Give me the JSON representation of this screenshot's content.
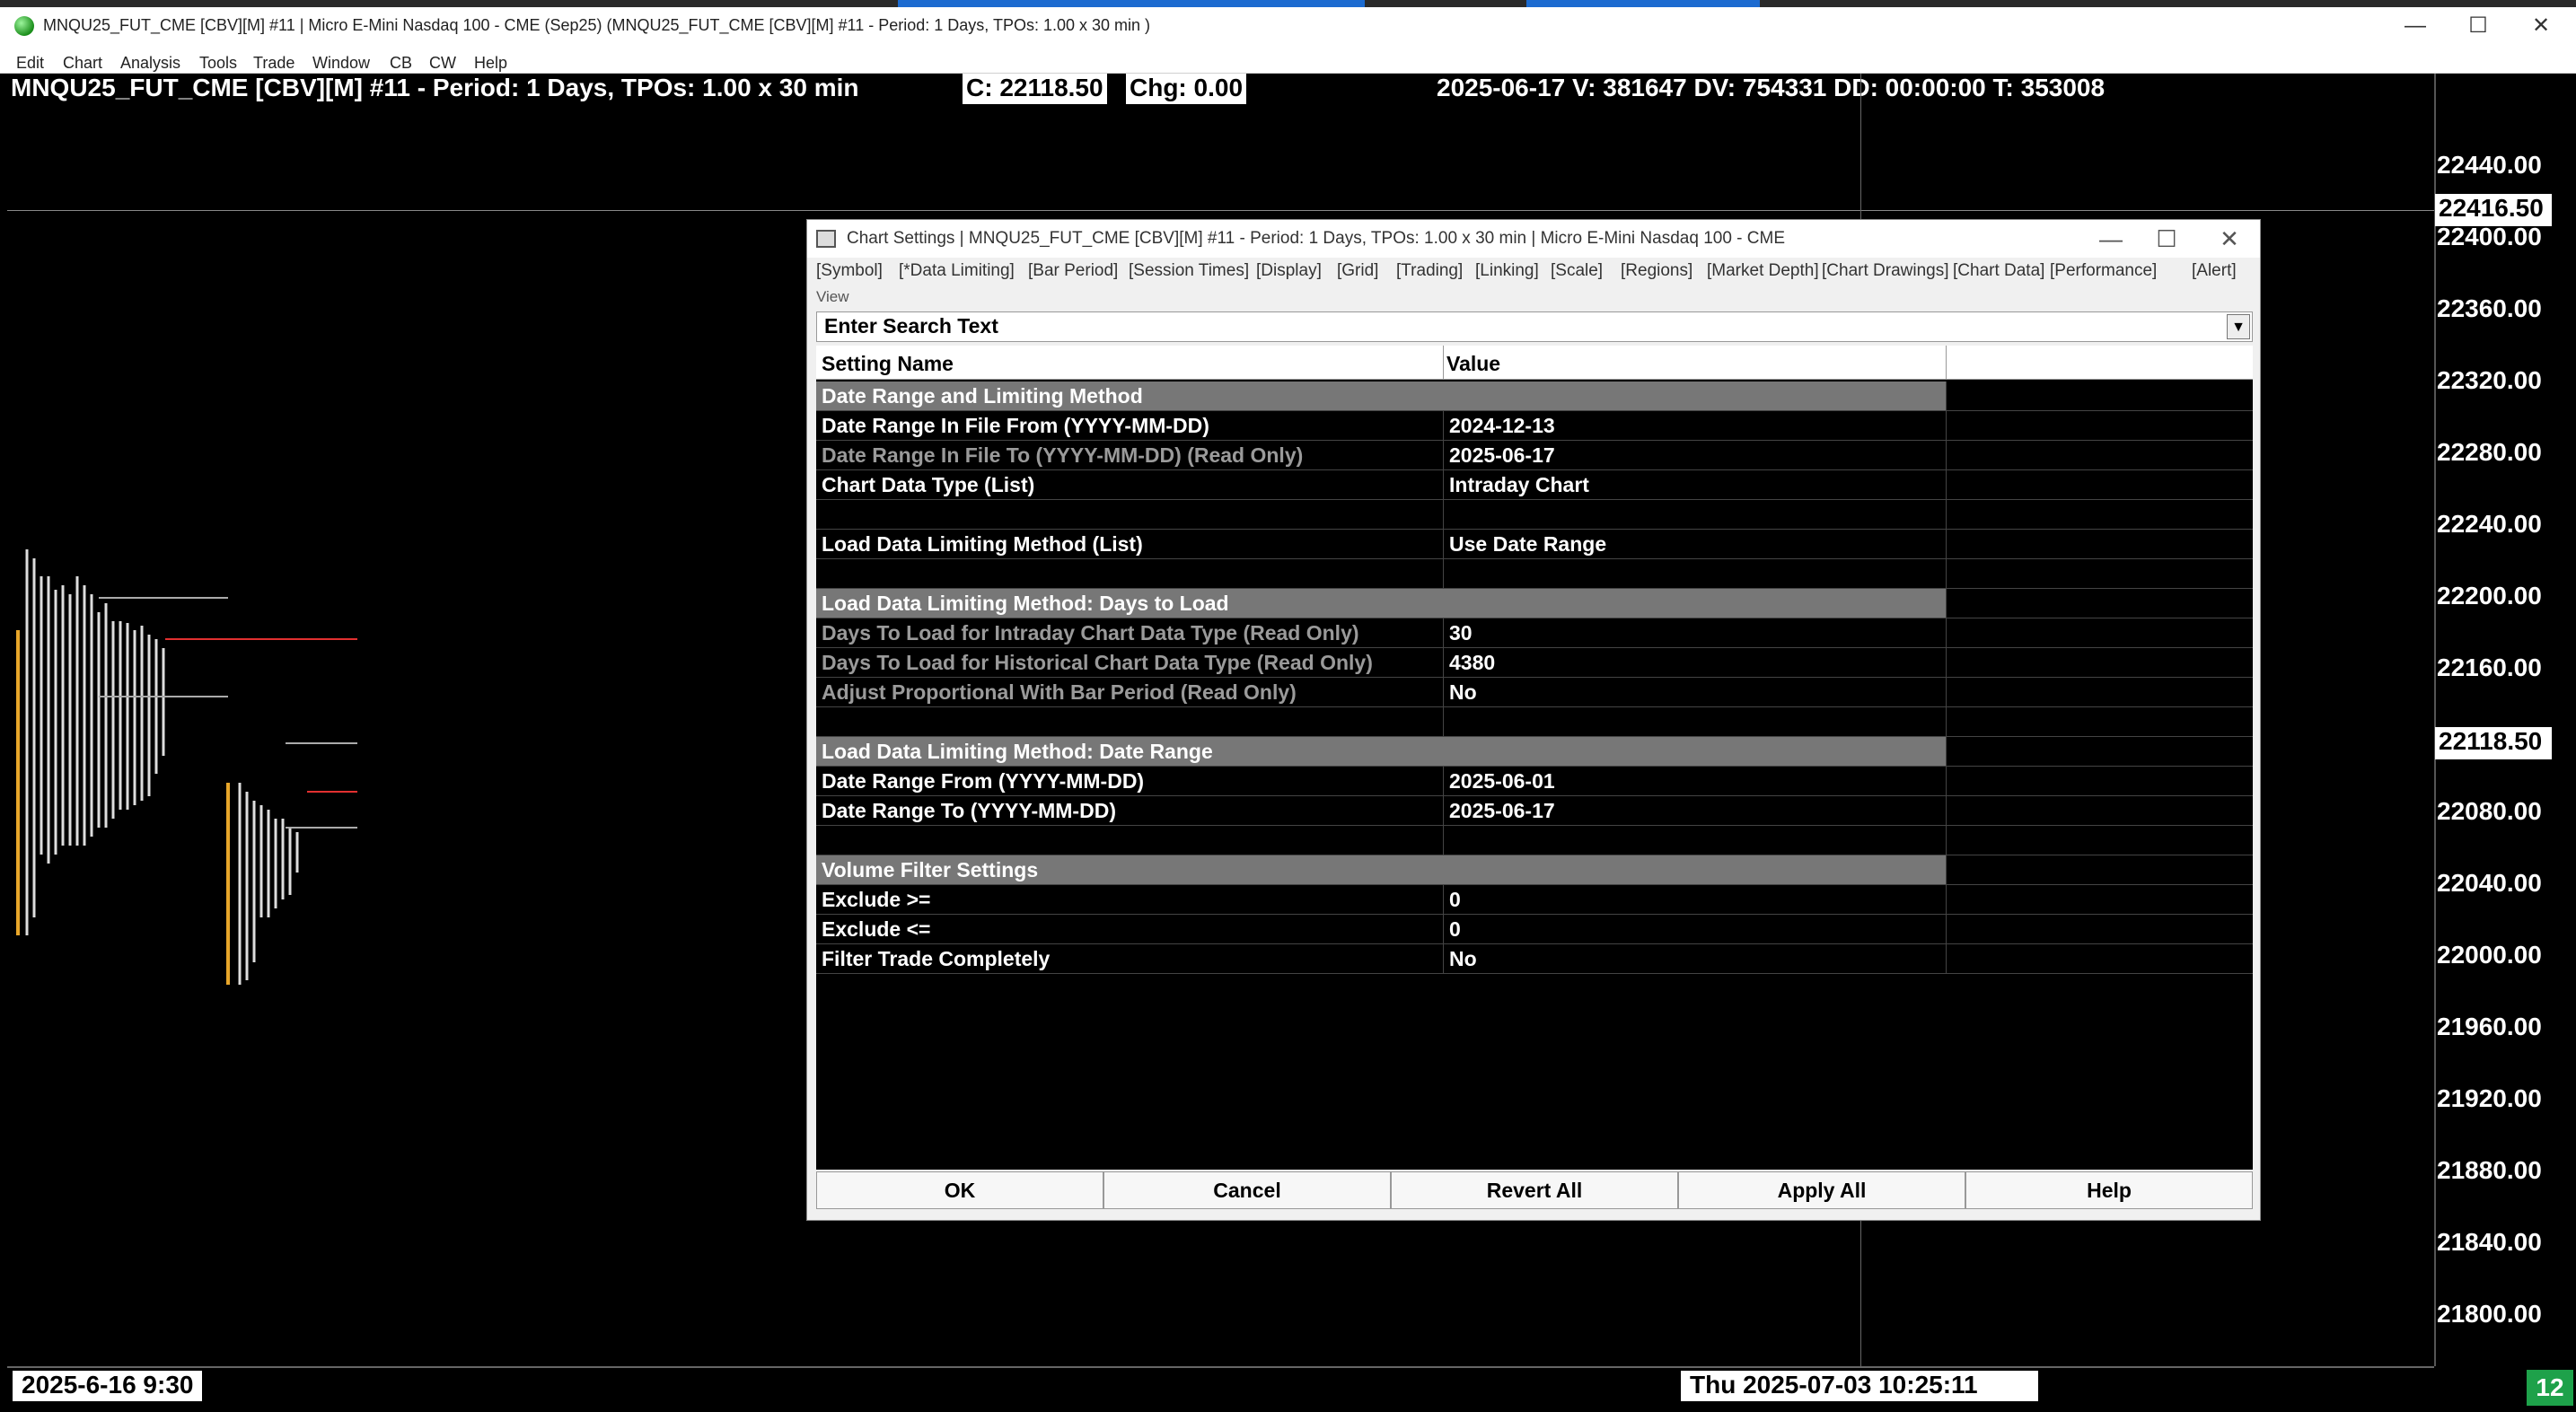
{
  "window": {
    "title": "MNQU25_FUT_CME [CBV][M] #11 | Micro E-Mini Nasdaq 100 - CME (Sep25) (MNQU25_FUT_CME [CBV][M] #11 - Period: 1 Days, TPOs: 1.00 x 30 min )"
  },
  "menu": [
    "Edit",
    "Chart",
    "Analysis",
    "Tools",
    "Trade",
    "Window",
    "CB",
    "CW",
    "Help"
  ],
  "chart": {
    "header_symbol": "MNQU25_FUT_CME [CBV][M] #11 - Period: 1 Days, TPOs: 1.00 x 30 min",
    "close": "C: 22118.50",
    "change": "Chg: 0.00",
    "stats": "2025-06-17 V: 381647 DV: 754331 DD: 00:00:00 T: 353008",
    "price_ticks": [
      "22440.00",
      "22400.00",
      "22360.00",
      "22320.00",
      "22280.00",
      "22240.00",
      "22200.00",
      "22160.00",
      "22080.00",
      "22040.00",
      "22000.00",
      "21960.00",
      "21920.00",
      "21880.00",
      "21840.00",
      "21800.00"
    ],
    "price_high_box": "22416.50",
    "price_last_box": "22118.50",
    "start_time": "2025-6-16  9:30",
    "cursor_time": "Thu 2025-07-03  10:25:11",
    "counter": "12"
  },
  "dialog": {
    "title": "Chart Settings | MNQU25_FUT_CME [CBV][M] #11 - Period: 1 Days, TPOs: 1.00 x 30 min  | Micro E-Mini Nasdaq 100 - CME",
    "tabs": [
      "[Symbol]",
      "[*Data Limiting]",
      "[Bar Period]",
      "[Session Times]",
      "[Display]",
      "[Grid]",
      "[Trading]",
      "[Linking]",
      "[Scale]",
      "[Regions]",
      "[Market Depth]",
      "[Chart Drawings]",
      "[Chart Data]",
      "[Performance]",
      "[Alert]"
    ],
    "view_label": "View",
    "search_placeholder": "Enter Search Text",
    "col_name": "Setting Name",
    "col_value": "Value",
    "rows": [
      {
        "name": "Date Range and Limiting Method",
        "value": "",
        "kind": "section"
      },
      {
        "name": "Date Range In File From (YYYY-MM-DD)",
        "value": "2024-12-13",
        "kind": "normal"
      },
      {
        "name": "Date Range In File To (YYYY-MM-DD) (Read Only)",
        "value": "2025-06-17",
        "kind": "ro"
      },
      {
        "name": "Chart Data Type (List)",
        "value": "Intraday Chart",
        "kind": "normal"
      },
      {
        "name": "",
        "value": "",
        "kind": "blank"
      },
      {
        "name": "Load Data Limiting Method (List)",
        "value": "Use Date Range",
        "kind": "normal"
      },
      {
        "name": "",
        "value": "",
        "kind": "blank"
      },
      {
        "name": "Load Data Limiting Method: Days to Load",
        "value": "",
        "kind": "section"
      },
      {
        "name": "Days To Load for Intraday Chart Data Type (Read Only)",
        "value": "30",
        "kind": "ro"
      },
      {
        "name": "Days To Load for Historical Chart Data Type (Read Only)",
        "value": "4380",
        "kind": "ro"
      },
      {
        "name": "Adjust Proportional With Bar Period (Read Only)",
        "value": "No",
        "kind": "ro"
      },
      {
        "name": "",
        "value": "",
        "kind": "blank"
      },
      {
        "name": "Load Data Limiting Method: Date Range",
        "value": "",
        "kind": "section"
      },
      {
        "name": "Date Range From (YYYY-MM-DD)",
        "value": "2025-06-01",
        "kind": "normal"
      },
      {
        "name": "Date Range To (YYYY-MM-DD)",
        "value": "2025-06-17",
        "kind": "normal"
      },
      {
        "name": "",
        "value": "",
        "kind": "blank"
      },
      {
        "name": "Volume Filter Settings",
        "value": "",
        "kind": "section"
      },
      {
        "name": "Exclude >=",
        "value": "0",
        "kind": "normal"
      },
      {
        "name": "Exclude <=",
        "value": "0",
        "kind": "normal"
      },
      {
        "name": "Filter Trade Completely",
        "value": "No",
        "kind": "normal"
      }
    ],
    "buttons": {
      "ok": "OK",
      "cancel": "Cancel",
      "revert": "Revert All",
      "apply": "Apply All",
      "help": "Help"
    }
  }
}
